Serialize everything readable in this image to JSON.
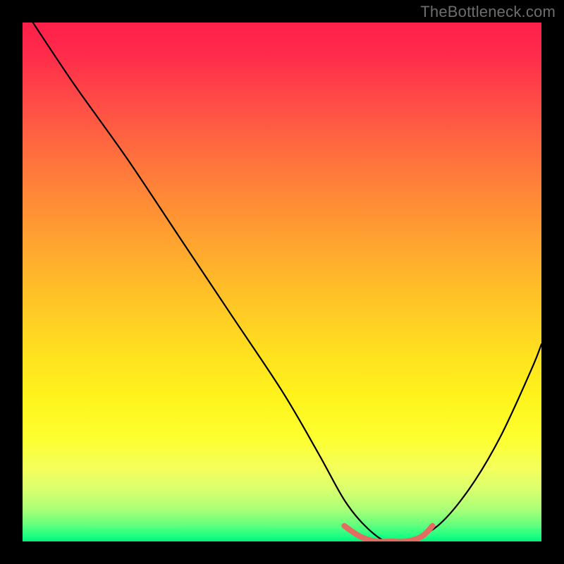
{
  "watermark": "TheBottleneck.com",
  "chart_data": {
    "type": "line",
    "title": "",
    "xlabel": "",
    "ylabel": "",
    "xlim": [
      0,
      100
    ],
    "ylim": [
      0,
      100
    ],
    "background_gradient": {
      "top": "#ff2049",
      "mid": "#ffe11f",
      "bottom": "#04f07a"
    },
    "series": [
      {
        "name": "bottleneck-curve",
        "color": "#000000",
        "x": [
          2,
          10,
          20,
          30,
          40,
          50,
          57,
          62,
          66,
          70,
          74,
          80,
          86,
          92,
          98,
          100
        ],
        "y": [
          100,
          88,
          74,
          59,
          44,
          29,
          17,
          8,
          3,
          0,
          0,
          3,
          10,
          20,
          33,
          38
        ]
      },
      {
        "name": "optimal-range",
        "color": "#e06c62",
        "x": [
          62,
          65,
          68,
          71,
          74,
          77,
          79
        ],
        "y": [
          3,
          1,
          0,
          0,
          0,
          1,
          3
        ]
      }
    ],
    "optimal_range_x": [
      62,
      79
    ]
  }
}
